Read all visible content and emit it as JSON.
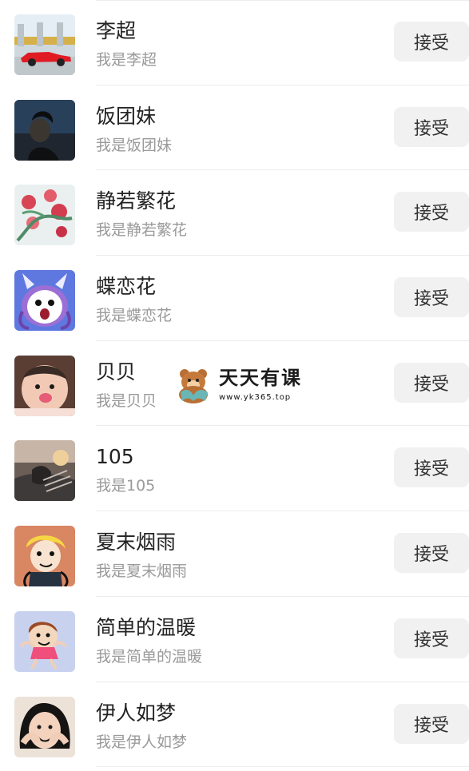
{
  "requests": [
    {
      "name": "李超",
      "message": "我是李超",
      "button": "接受",
      "avatar": "red-sports-car-photo"
    },
    {
      "name": "饭团妹",
      "message": "我是饭团妹",
      "button": "接受",
      "avatar": "woman-silhouette-photo"
    },
    {
      "name": "静若繁花",
      "message": "我是静若繁花",
      "button": "接受",
      "avatar": "roses-painting-photo"
    },
    {
      "name": "蝶恋花",
      "message": "我是蝶恋花",
      "button": "接受",
      "avatar": "purple-cartoon-avatar"
    },
    {
      "name": "贝贝",
      "message": "我是贝贝",
      "button": "接受",
      "avatar": "baby-face-photo"
    },
    {
      "name": "105",
      "message": "我是105",
      "button": "接受",
      "avatar": "sunset-couple-photo"
    },
    {
      "name": "夏末烟雨",
      "message": "我是夏末烟雨",
      "button": "接受",
      "avatar": "yellow-hair-cartoon-avatar"
    },
    {
      "name": "简单的温暖",
      "message": "我是简单的温暖",
      "button": "接受",
      "avatar": "crayon-girl-cartoon-avatar"
    },
    {
      "name": "伊人如梦",
      "message": "我是伊人如梦",
      "button": "接受",
      "avatar": "girl-photo"
    }
  ],
  "watermark": {
    "brand": "天天有课",
    "url": "www.yk365.top",
    "icon": "bear-reading-icon"
  },
  "colors": {
    "button_bg": "#f1f1f1",
    "name": "#222222",
    "message": "#9a9a9a",
    "divider": "#ececec"
  }
}
